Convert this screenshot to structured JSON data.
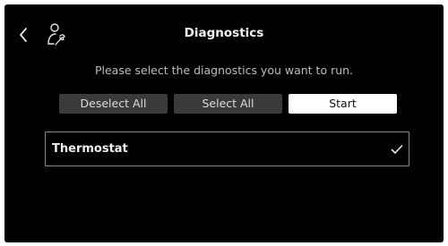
{
  "header": {
    "title": "Diagnostics",
    "back_icon": "chevron-left-icon",
    "technician_icon": "technician-icon"
  },
  "main": {
    "prompt": "Please select the diagnostics you want to run.",
    "buttons": {
      "deselect_all": "Deselect All",
      "select_all": "Select All",
      "start": "Start"
    },
    "items": [
      {
        "label": "Thermostat",
        "selected": true,
        "icon": "checkmark-icon"
      }
    ]
  },
  "colors": {
    "background": "#000000",
    "button_dark": "#3a3a3a",
    "button_primary": "#ffffff",
    "item_border": "#8a8a8a"
  }
}
